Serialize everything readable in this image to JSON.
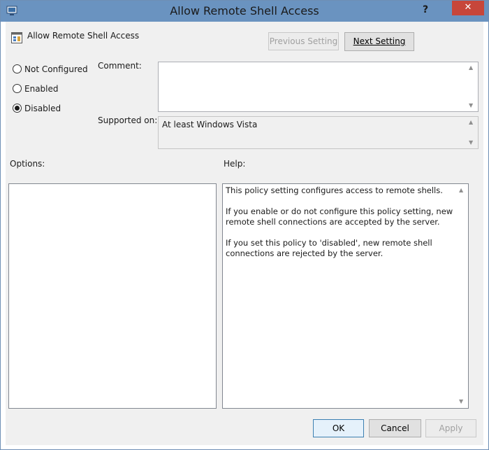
{
  "window": {
    "title": "Allow Remote Shell Access",
    "help_glyph": "?",
    "close_glyph": "✕"
  },
  "header": {
    "policy_title": "Allow Remote Shell Access",
    "previous_label": "Previous Setting",
    "next_label": "Next Setting"
  },
  "state": {
    "not_configured": {
      "label": "Not Configured",
      "checked": false
    },
    "enabled": {
      "label": "Enabled",
      "checked": false
    },
    "disabled": {
      "label": "Disabled",
      "checked": true
    }
  },
  "comment": {
    "label": "Comment:",
    "value": ""
  },
  "supported": {
    "label": "Supported on:",
    "value": "At least Windows Vista"
  },
  "options": {
    "label": "Options:"
  },
  "help": {
    "label": "Help:",
    "paragraphs": [
      "This policy setting configures access to remote shells.",
      "If you enable or do not configure this policy setting, new remote shell connections are accepted by the server.",
      "If you set this policy to 'disabled', new remote shell connections are rejected by the server."
    ]
  },
  "footer": {
    "ok_label": "OK",
    "cancel_label": "Cancel",
    "apply_label": "Apply"
  },
  "colors": {
    "titlebar": "#6a93c0",
    "close_button": "#c7463a",
    "client_background": "#f0f0f0"
  }
}
